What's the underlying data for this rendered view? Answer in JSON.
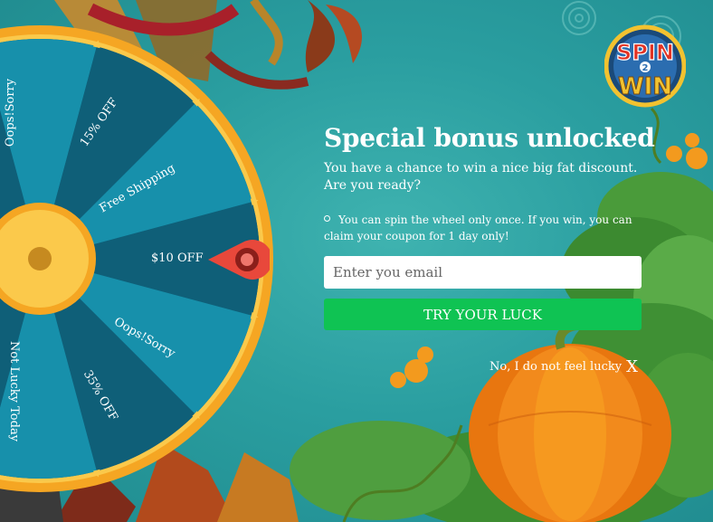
{
  "promo": {
    "title": "Special bonus unlocked",
    "subtitle": "You have a chance to win a nice big fat discount. Are you ready?",
    "rule": "You can spin the wheel only once. If you win, you can claim your coupon for 1 day only!",
    "email_placeholder": "Enter you email",
    "email_value": "",
    "submit_label": "TRY YOUR LUCK",
    "decline_label": "No, I do not feel lucky",
    "decline_close": "X"
  },
  "logo": {
    "word_top": "SPIN",
    "connector": "2",
    "word_bottom": "WIN"
  },
  "wheel": {
    "segments": [
      {
        "label": "Oops!Sorry"
      },
      {
        "label": "15% OFF"
      },
      {
        "label": "Free Shipping"
      },
      {
        "label": "$10 OFF"
      },
      {
        "label": "Oops!Sorry"
      },
      {
        "label": "35% OFF"
      },
      {
        "label": "Not Lucky Today"
      }
    ]
  },
  "colors": {
    "background": "#2a9ea0",
    "wheel_rim": "#f5a623",
    "segment_dark": "#0f5f78",
    "segment_light": "#1790ab",
    "button": "#0fc353",
    "pointer": "#e8483b",
    "text": "#ffffff"
  },
  "icons": {
    "pointer": "map-pin-pointer-icon",
    "decline": "close-x-icon"
  }
}
